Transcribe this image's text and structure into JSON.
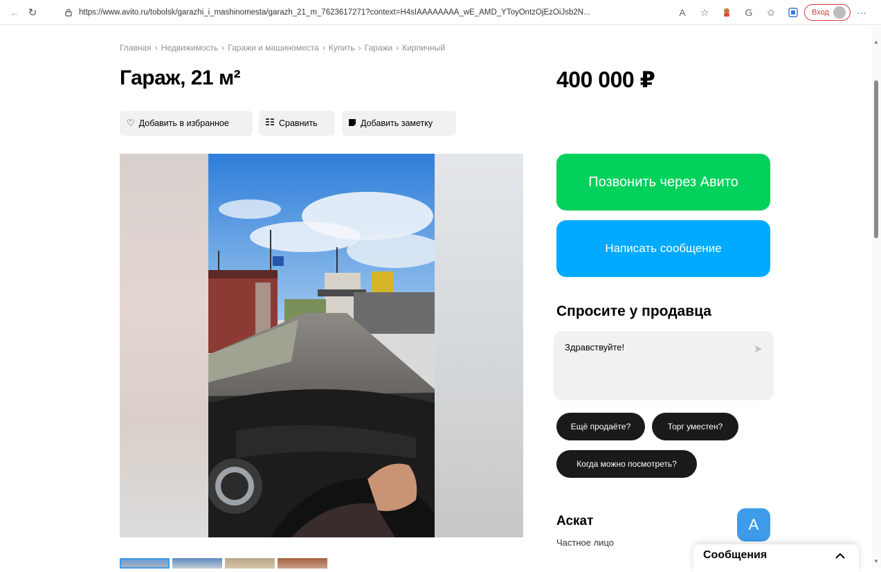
{
  "browser": {
    "url": "https://www.avito.ru/tobolsk/garazhi_i_mashinomesta/garazh_21_m_7623617271?context=H4sIAAAAAAAA_wE_AMD_YToyOntzOjEzOiJsb2N...",
    "login_label": "Вход"
  },
  "breadcrumb": [
    "Главная",
    "Недвижимость",
    "Гаражи и машиноместа",
    "Купить",
    "Гаражи",
    "Кирпичный"
  ],
  "listing": {
    "title": "Гараж, 21 м²",
    "price": "400 000 ₽"
  },
  "actions": {
    "favorite": "Добавить в избранное",
    "compare": "Сравнить",
    "note": "Добавить заметку"
  },
  "contact": {
    "call_label": "Позвонить через Авито",
    "message_label": "Написать сообщение"
  },
  "ask": {
    "title": "Спросите у продавца",
    "input_value": "Здравствуйте!",
    "chips": [
      "Ещё продаёте?",
      "Торг уместен?",
      "Когда можно посмотреть?"
    ]
  },
  "seller": {
    "name": "Аскат",
    "type": "Частное лицо",
    "avatar_letter": "А"
  },
  "messages_panel": {
    "title": "Сообщения"
  },
  "colors": {
    "call_green": "#02d15c",
    "message_blue": "#00aaff",
    "chip_dark": "#1a1a1a",
    "avatar_blue": "#3d9be9"
  }
}
